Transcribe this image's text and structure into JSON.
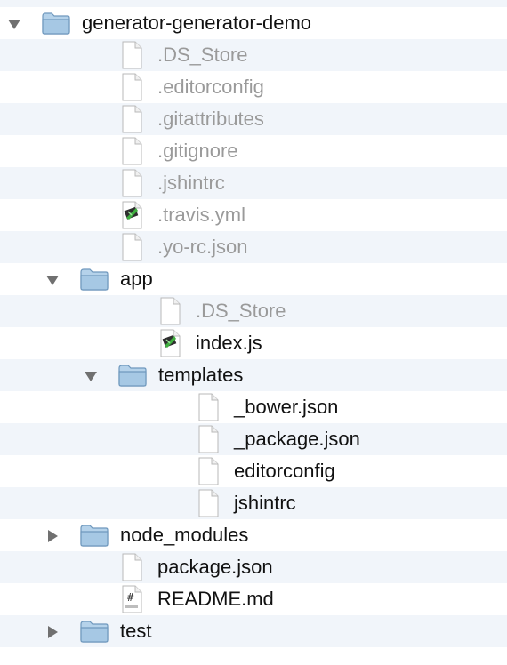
{
  "file_tree": {
    "items": [
      {
        "label": "generator-generator-demo",
        "kind": "folder",
        "depth": 0,
        "expanded": true,
        "dim": false
      },
      {
        "label": ".DS_Store",
        "kind": "file",
        "icon": "blank",
        "depth": 1,
        "dim": true
      },
      {
        "label": ".editorconfig",
        "kind": "file",
        "icon": "blank",
        "depth": 1,
        "dim": true
      },
      {
        "label": ".gitattributes",
        "kind": "file",
        "icon": "blank",
        "depth": 1,
        "dim": true
      },
      {
        "label": ".gitignore",
        "kind": "file",
        "icon": "blank",
        "depth": 1,
        "dim": true
      },
      {
        "label": ".jshintrc",
        "kind": "file",
        "icon": "blank",
        "depth": 1,
        "dim": true
      },
      {
        "label": ".travis.yml",
        "kind": "file",
        "icon": "script",
        "depth": 1,
        "dim": true
      },
      {
        "label": ".yo-rc.json",
        "kind": "file",
        "icon": "blank",
        "depth": 1,
        "dim": true
      },
      {
        "label": "app",
        "kind": "folder",
        "depth": 1,
        "expanded": true,
        "dim": false
      },
      {
        "label": ".DS_Store",
        "kind": "file",
        "icon": "blank",
        "depth": 2,
        "dim": true
      },
      {
        "label": "index.js",
        "kind": "file",
        "icon": "script",
        "depth": 2,
        "dim": false
      },
      {
        "label": "templates",
        "kind": "folder",
        "depth": 2,
        "expanded": true,
        "dim": false
      },
      {
        "label": "_bower.json",
        "kind": "file",
        "icon": "blank",
        "depth": 3,
        "dim": false
      },
      {
        "label": "_package.json",
        "kind": "file",
        "icon": "blank",
        "depth": 3,
        "dim": false
      },
      {
        "label": "editorconfig",
        "kind": "file",
        "icon": "blank",
        "depth": 3,
        "dim": false
      },
      {
        "label": "jshintrc",
        "kind": "file",
        "icon": "blank",
        "depth": 3,
        "dim": false
      },
      {
        "label": "node_modules",
        "kind": "folder",
        "depth": 1,
        "expanded": false,
        "dim": false
      },
      {
        "label": "package.json",
        "kind": "file",
        "icon": "blank",
        "depth": 1,
        "dim": false
      },
      {
        "label": "README.md",
        "kind": "file",
        "icon": "markdown",
        "depth": 1,
        "dim": false
      },
      {
        "label": "test",
        "kind": "folder",
        "depth": 1,
        "expanded": false,
        "dim": false
      }
    ]
  },
  "colors": {
    "stripe": "#f1f5fa",
    "text": "#111111",
    "dim_text": "#9a9a9a",
    "folder_fill": "#b5d2ea",
    "folder_stroke": "#6f98bd",
    "disclosure": "#707070"
  }
}
